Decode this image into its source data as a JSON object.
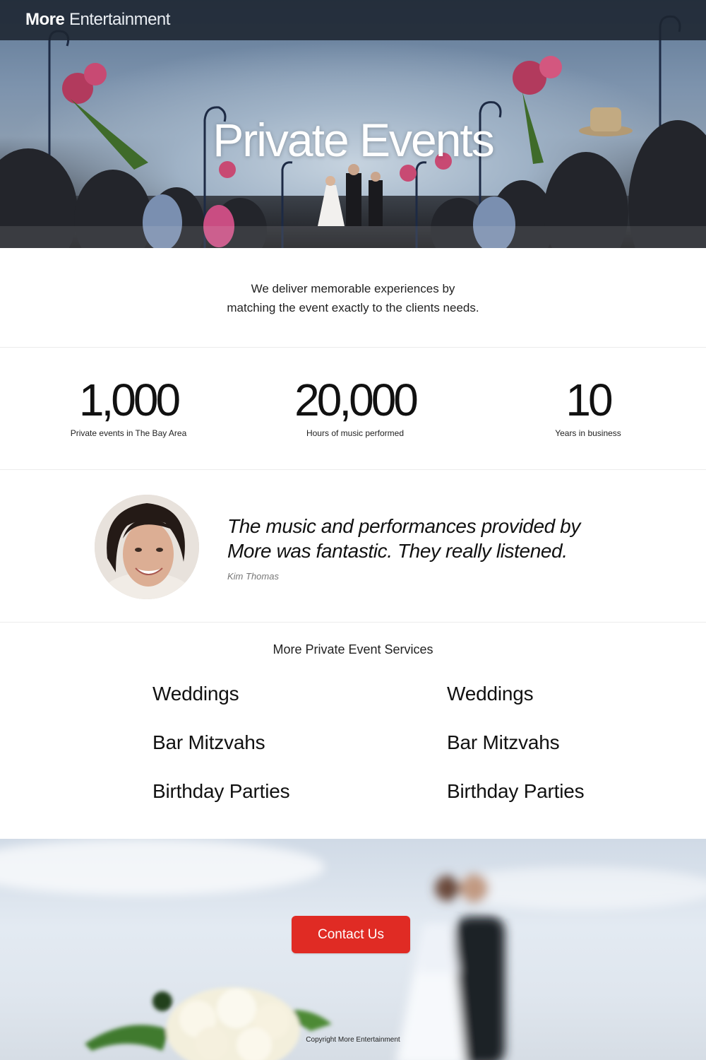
{
  "header": {
    "logo_bold": "More",
    "logo_light": "Entertainment"
  },
  "hero": {
    "title": "Private Events"
  },
  "intro": {
    "line1": "We deliver memorable experiences by",
    "line2": "matching the event exactly to the clients needs."
  },
  "stats": [
    {
      "number": "1,000",
      "label": "Private events in The Bay Area"
    },
    {
      "number": "20,000",
      "label": "Hours of music performed"
    },
    {
      "number": "10",
      "label": "Years in business"
    }
  ],
  "testimonial": {
    "quote_line1": "The music and performances provided by",
    "quote_line2": "More was fantastic. They really listened.",
    "author": "Kim Thomas"
  },
  "services": {
    "title": "More Private Event Services",
    "left": [
      "Weddings",
      "Bar Mitzvahs",
      "Birthday Parties"
    ],
    "right": [
      "Weddings",
      "Bar Mitzvahs",
      "Birthday Parties"
    ]
  },
  "footer": {
    "contact_label": "Contact Us",
    "copyright": "Copyright More Entertainment"
  },
  "colors": {
    "accent": "#e02b24",
    "navbar": "#1c2430"
  }
}
